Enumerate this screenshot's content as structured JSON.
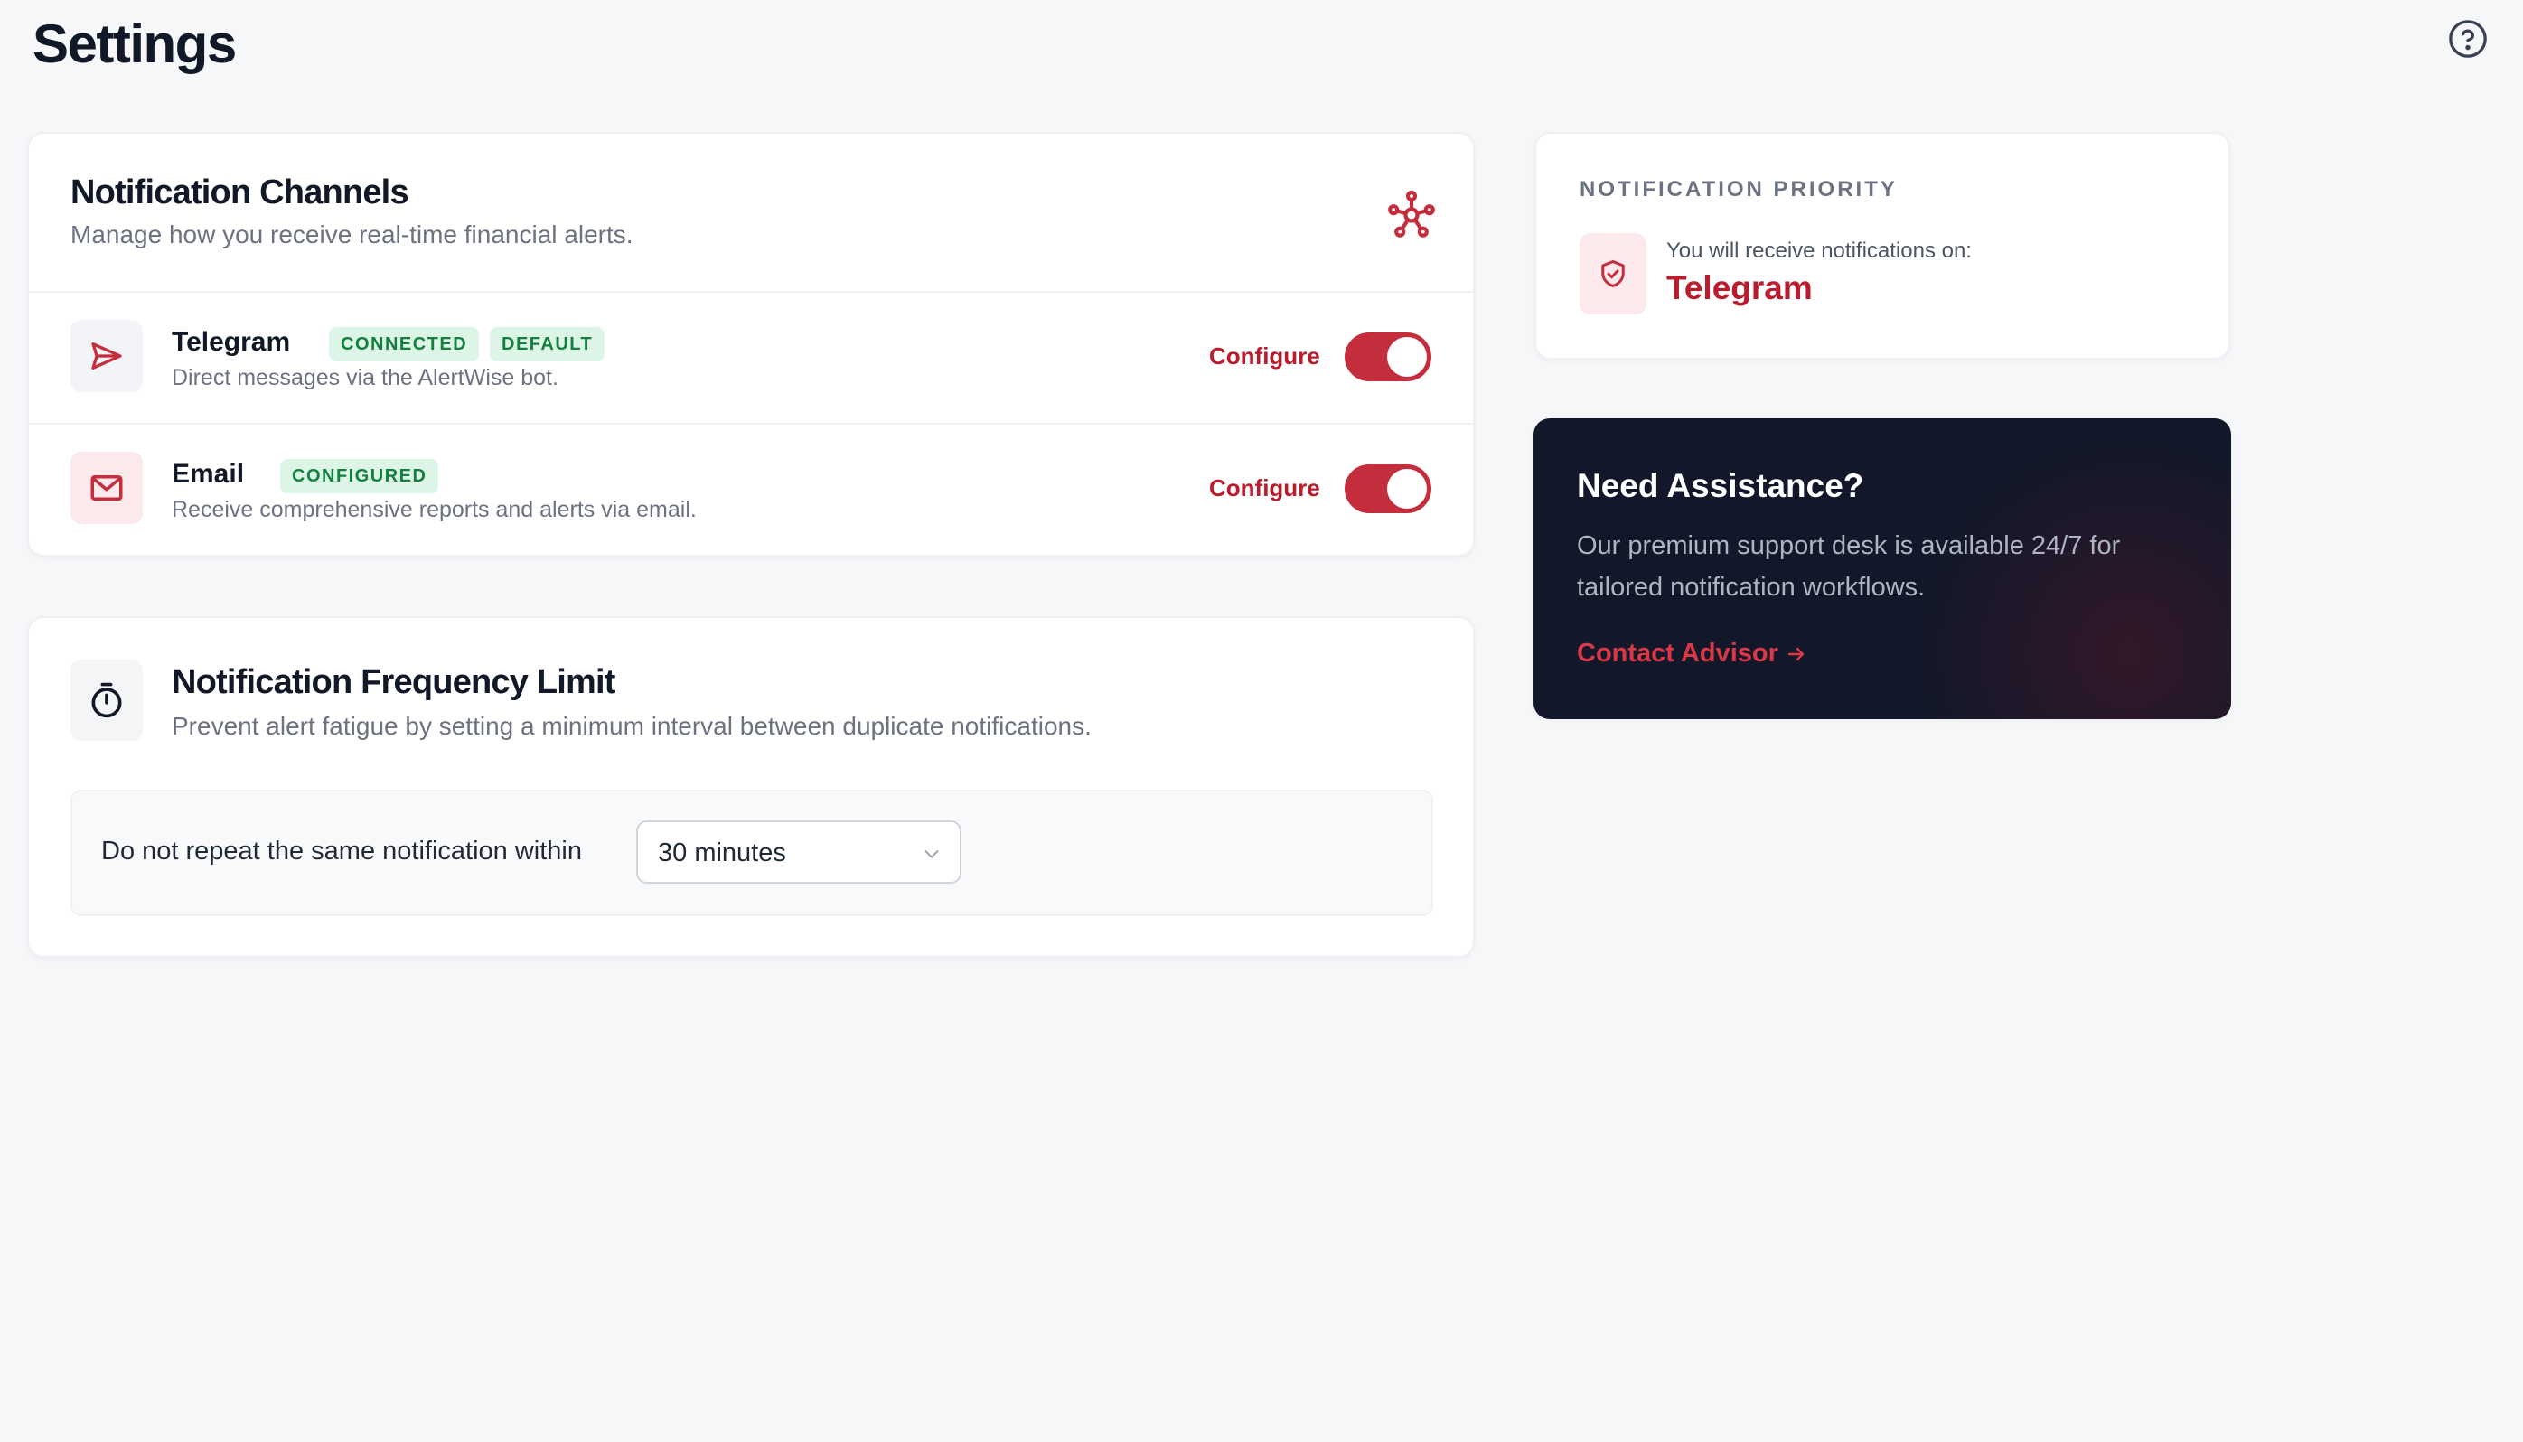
{
  "page": {
    "title": "Settings",
    "help_icon": "question-circle-icon"
  },
  "channels": {
    "title": "Notification Channels",
    "subtitle": "Manage how you receive real-time financial alerts.",
    "header_icon": "network-icon",
    "items": [
      {
        "name": "Telegram",
        "icon": "send-icon",
        "badges": [
          "CONNECTED",
          "DEFAULT"
        ],
        "description": "Direct messages via the AlertWise bot.",
        "configure_label": "Configure",
        "enabled": true
      },
      {
        "name": "Email",
        "icon": "mail-icon",
        "badges": [
          "CONFIGURED"
        ],
        "description": "Receive comprehensive reports and alerts via email.",
        "configure_label": "Configure",
        "enabled": true
      }
    ]
  },
  "frequency": {
    "title": "Notification Frequency Limit",
    "subtitle": "Prevent alert fatigue by setting a minimum interval between duplicate notifications.",
    "icon": "stopwatch-icon",
    "label": "Do not repeat the same notification within",
    "selected": "30 minutes"
  },
  "priority": {
    "heading": "NOTIFICATION PRIORITY",
    "icon": "shield-check-icon",
    "label": "You will receive notifications on:",
    "value": "Telegram"
  },
  "assistance": {
    "title": "Need Assistance?",
    "text": "Our premium support desk is available 24/7 for tailored notification workflows.",
    "link_label": "Contact Advisor",
    "link_icon": "arrow-right-icon"
  },
  "colors": {
    "accent": "#c42d3b",
    "badge_bg": "#dcf5e7",
    "badge_text": "#15803d",
    "dark_card": "#121829",
    "background": "#f6f7f9"
  }
}
